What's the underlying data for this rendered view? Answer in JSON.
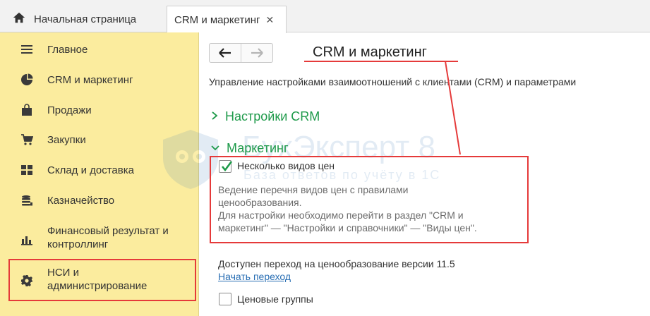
{
  "tabs": {
    "home_label": "Начальная страница",
    "active_label": "CRM и маркетинг",
    "close_glyph": "✕"
  },
  "sidebar": {
    "items": [
      {
        "label": "Главное",
        "icon": "menu-icon"
      },
      {
        "label": "CRM и маркетинг",
        "icon": "pie-chart-icon"
      },
      {
        "label": "Продажи",
        "icon": "bag-icon"
      },
      {
        "label": "Закупки",
        "icon": "cart-icon"
      },
      {
        "label": "Склад и доставка",
        "icon": "warehouse-icon"
      },
      {
        "label": "Казначейство",
        "icon": "coins-icon"
      },
      {
        "label": "Финансовый результат и\nконтроллинг",
        "icon": "bar-chart-icon"
      },
      {
        "label": "НСИ и\nадминистрирование",
        "icon": "gear-icon"
      }
    ]
  },
  "main": {
    "back_glyph": "🡐",
    "forward_glyph": "🡒",
    "title": "CRM и маркетинг",
    "description": "Управление настройками взаимоотношений с клиентами (CRM) и параметрами",
    "section_crm": "Настройки CRM",
    "section_marketing": "Маркетинг",
    "chevron_collapsed": ">",
    "chevron_expanded": "⌄",
    "multi_price_label": "Несколько видов цен",
    "multi_price_checked": true,
    "hint_lines": [
      "Ведение перечня видов цен с правилами",
      "ценообразования.",
      "Для настройки необходимо перейти в раздел \"CRM и",
      "маркетинг\" — \"Настройки и справочники\" — \"Виды цен\"."
    ],
    "pricing_transition_text": "Доступен переход на ценообразование версии 11.5",
    "start_transition_link": "Начать переход",
    "price_groups_label": "Ценовые группы",
    "price_groups_checked": false
  },
  "watermark": {
    "brand": "БухЭксперт 8",
    "tagline": "База ответов по учёту в 1С"
  },
  "colors": {
    "sidebar_bg": "#fbec9e",
    "highlight_red": "#e53a3a",
    "section_green": "#1e9a4a",
    "link_blue": "#2a6fb4"
  }
}
